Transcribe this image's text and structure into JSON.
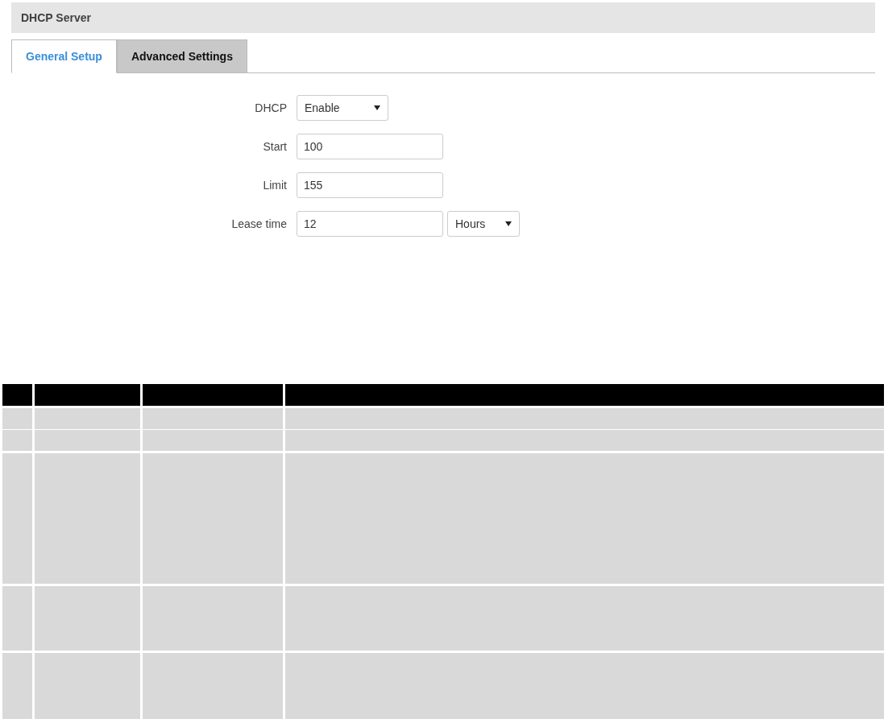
{
  "panel": {
    "title": "DHCP Server"
  },
  "tabs": [
    {
      "label": "General Setup",
      "selected": true
    },
    {
      "label": "Advanced Settings",
      "selected": false
    }
  ],
  "form": [
    {
      "kind": "select",
      "label": "DHCP",
      "value": "Enable"
    },
    {
      "kind": "input",
      "label": "Start",
      "value": "100"
    },
    {
      "kind": "input",
      "label": "Limit",
      "value": "155"
    },
    {
      "kind": "input-select",
      "label": "Lease time",
      "value": "12",
      "unit": "Hours"
    }
  ]
}
